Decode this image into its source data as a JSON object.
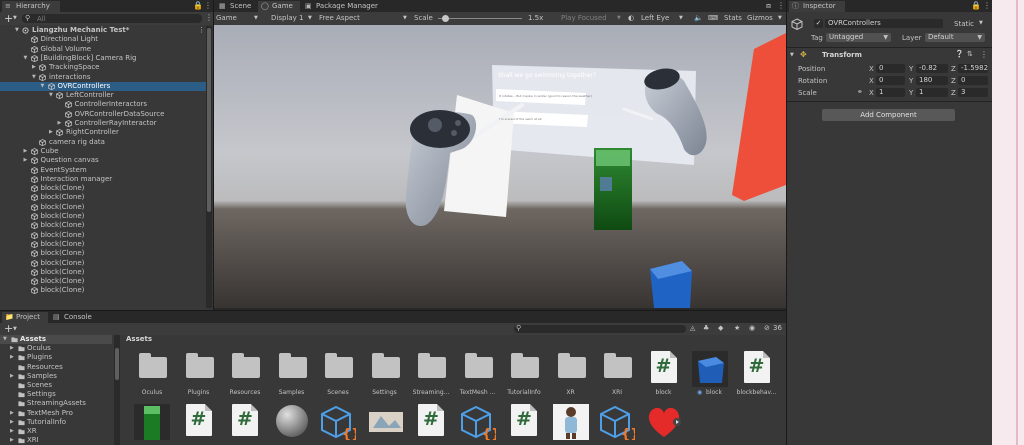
{
  "hierarchy": {
    "tab": "Hierarchy",
    "add": "+",
    "search_placeholder": "All",
    "rows": [
      {
        "label": "Liangzhu Mechanic Test*",
        "depth": 0,
        "arrow": "open",
        "icon": "scene-icon",
        "bold": true
      },
      {
        "label": "Directional Light",
        "depth": 1,
        "arrow": "",
        "icon": "cube-icon"
      },
      {
        "label": "Global Volume",
        "depth": 1,
        "arrow": "",
        "icon": "cube-icon"
      },
      {
        "label": "[BuildingBlock] Camera Rig",
        "depth": 1,
        "arrow": "open",
        "icon": "cube-icon"
      },
      {
        "label": "TrackingSpace",
        "depth": 2,
        "arrow": "closed",
        "icon": "cube-icon"
      },
      {
        "label": "interactions",
        "depth": 2,
        "arrow": "open",
        "icon": "cube-icon"
      },
      {
        "label": "OVRControllers",
        "depth": 3,
        "arrow": "open",
        "icon": "cube-icon",
        "selected": true
      },
      {
        "label": "LeftController",
        "depth": 4,
        "arrow": "open",
        "icon": "cube-icon"
      },
      {
        "label": "ControllerInteractors",
        "depth": 5,
        "arrow": "",
        "icon": "cube-icon"
      },
      {
        "label": "OVRControllerDataSource",
        "depth": 5,
        "arrow": "",
        "icon": "cube-icon"
      },
      {
        "label": "ControllerRayInteractor",
        "depth": 5,
        "arrow": "closed",
        "icon": "cube-icon"
      },
      {
        "label": "RightController",
        "depth": 4,
        "arrow": "closed",
        "icon": "cube-icon"
      },
      {
        "label": "camera rig data",
        "depth": 2,
        "arrow": "",
        "icon": "cube-icon"
      },
      {
        "label": "Cube",
        "depth": 1,
        "arrow": "closed",
        "icon": "cube-icon"
      },
      {
        "label": "Question canvas",
        "depth": 1,
        "arrow": "closed",
        "icon": "cube-icon"
      },
      {
        "label": "EventSystem",
        "depth": 1,
        "arrow": "",
        "icon": "cube-icon"
      },
      {
        "label": "Interaction manager",
        "depth": 1,
        "arrow": "",
        "icon": "cube-icon"
      },
      {
        "label": "block(Clone)",
        "depth": 1,
        "arrow": "",
        "icon": "cube-icon"
      },
      {
        "label": "block(Clone)",
        "depth": 1,
        "arrow": "",
        "icon": "cube-icon"
      },
      {
        "label": "block(Clone)",
        "depth": 1,
        "arrow": "",
        "icon": "cube-icon"
      },
      {
        "label": "block(Clone)",
        "depth": 1,
        "arrow": "",
        "icon": "cube-icon"
      },
      {
        "label": "block(Clone)",
        "depth": 1,
        "arrow": "",
        "icon": "cube-icon"
      },
      {
        "label": "block(Clone)",
        "depth": 1,
        "arrow": "",
        "icon": "cube-icon"
      },
      {
        "label": "block(Clone)",
        "depth": 1,
        "arrow": "",
        "icon": "cube-icon"
      },
      {
        "label": "block(Clone)",
        "depth": 1,
        "arrow": "",
        "icon": "cube-icon"
      },
      {
        "label": "block(Clone)",
        "depth": 1,
        "arrow": "",
        "icon": "cube-icon"
      },
      {
        "label": "block(Clone)",
        "depth": 1,
        "arrow": "",
        "icon": "cube-icon"
      },
      {
        "label": "block(Clone)",
        "depth": 1,
        "arrow": "",
        "icon": "cube-icon"
      },
      {
        "label": "block(Clone)",
        "depth": 1,
        "arrow": "",
        "icon": "cube-icon"
      }
    ]
  },
  "center_tabs": {
    "scene": "Scene",
    "game": "Game",
    "package_manager": "Package Manager"
  },
  "game_toolbar": {
    "display_mode": "Game",
    "display": "Display 1",
    "aspect": "Free Aspect",
    "scale_label": "Scale",
    "scale_value": "1.5x",
    "scale_fraction": 0.08,
    "play_focused": "Play Focused",
    "eye": "Left Eye",
    "stats": "Stats",
    "gizmos": "Gizmos"
  },
  "game_view": {
    "question": "Shall we go swimming together?",
    "option1": "It rotates... But maybe in winter (good to reason the weather)",
    "option2": "I'm scared of the swim at all"
  },
  "inspector": {
    "tab": "Inspector",
    "object_name": "OVRControllers",
    "static_label": "Static",
    "tag_label": "Tag",
    "tag_value": "Untagged",
    "layer_label": "Layer",
    "layer_value": "Default",
    "transform_title": "Transform",
    "position_label": "Position",
    "rotation_label": "Rotation",
    "scale_label": "Scale",
    "position": {
      "x": "0",
      "y": "-0.82",
      "z": "-1.5982"
    },
    "rotation": {
      "x": "0",
      "y": "180",
      "z": "0"
    },
    "scale": {
      "x": "1",
      "y": "1",
      "z": "3"
    },
    "axis_x": "X",
    "axis_y": "Y",
    "axis_z": "Z",
    "add_component": "Add Component"
  },
  "bottom_tabs": {
    "project": "Project",
    "console": "Console"
  },
  "project": {
    "add": "+",
    "hidden_count": "36",
    "tree": [
      {
        "label": "Assets",
        "depth": 0,
        "arrow": "open",
        "selected": true
      },
      {
        "label": "Oculus",
        "depth": 1,
        "arrow": "closed"
      },
      {
        "label": "Plugins",
        "depth": 1,
        "arrow": "closed"
      },
      {
        "label": "Resources",
        "depth": 1,
        "arrow": ""
      },
      {
        "label": "Samples",
        "depth": 1,
        "arrow": "closed"
      },
      {
        "label": "Scenes",
        "depth": 1,
        "arrow": ""
      },
      {
        "label": "Settings",
        "depth": 1,
        "arrow": ""
      },
      {
        "label": "StreamingAssets",
        "depth": 1,
        "arrow": ""
      },
      {
        "label": "TextMesh Pro",
        "depth": 1,
        "arrow": "closed"
      },
      {
        "label": "TutorialInfo",
        "depth": 1,
        "arrow": "closed"
      },
      {
        "label": "XR",
        "depth": 1,
        "arrow": "closed"
      },
      {
        "label": "XRI",
        "depth": 1,
        "arrow": "closed"
      }
    ],
    "breadcrumb": "Assets",
    "assets_row1": [
      {
        "name": "Oculus",
        "kind": "folder"
      },
      {
        "name": "Plugins",
        "kind": "folder"
      },
      {
        "name": "Resources",
        "kind": "folder"
      },
      {
        "name": "Samples",
        "kind": "folder"
      },
      {
        "name": "Scenes",
        "kind": "folder"
      },
      {
        "name": "Settings",
        "kind": "folder"
      },
      {
        "name": "Streaming...",
        "kind": "folder"
      },
      {
        "name": "TextMesh ...",
        "kind": "folder"
      },
      {
        "name": "TutorialInfo",
        "kind": "folder"
      },
      {
        "name": "XR",
        "kind": "folder"
      },
      {
        "name": "XRI",
        "kind": "folder"
      },
      {
        "name": "block",
        "kind": "script"
      },
      {
        "name": "block",
        "kind": "prefab-cube"
      },
      {
        "name": "blockbehav...",
        "kind": "script"
      }
    ],
    "assets_row2": [
      {
        "name": "",
        "kind": "material-green"
      },
      {
        "name": "",
        "kind": "script"
      },
      {
        "name": "",
        "kind": "script"
      },
      {
        "name": "",
        "kind": "sphere"
      },
      {
        "name": "",
        "kind": "json-cube"
      },
      {
        "name": "",
        "kind": "image"
      },
      {
        "name": "",
        "kind": "script"
      },
      {
        "name": "",
        "kind": "json-cube"
      },
      {
        "name": "",
        "kind": "script"
      },
      {
        "name": "",
        "kind": "figure"
      },
      {
        "name": "",
        "kind": "json-cube"
      },
      {
        "name": "",
        "kind": "heart"
      }
    ]
  },
  "colors": {
    "selection": "#2c5d87",
    "panel": "#383838",
    "script_hash": "#2e6a3a"
  }
}
